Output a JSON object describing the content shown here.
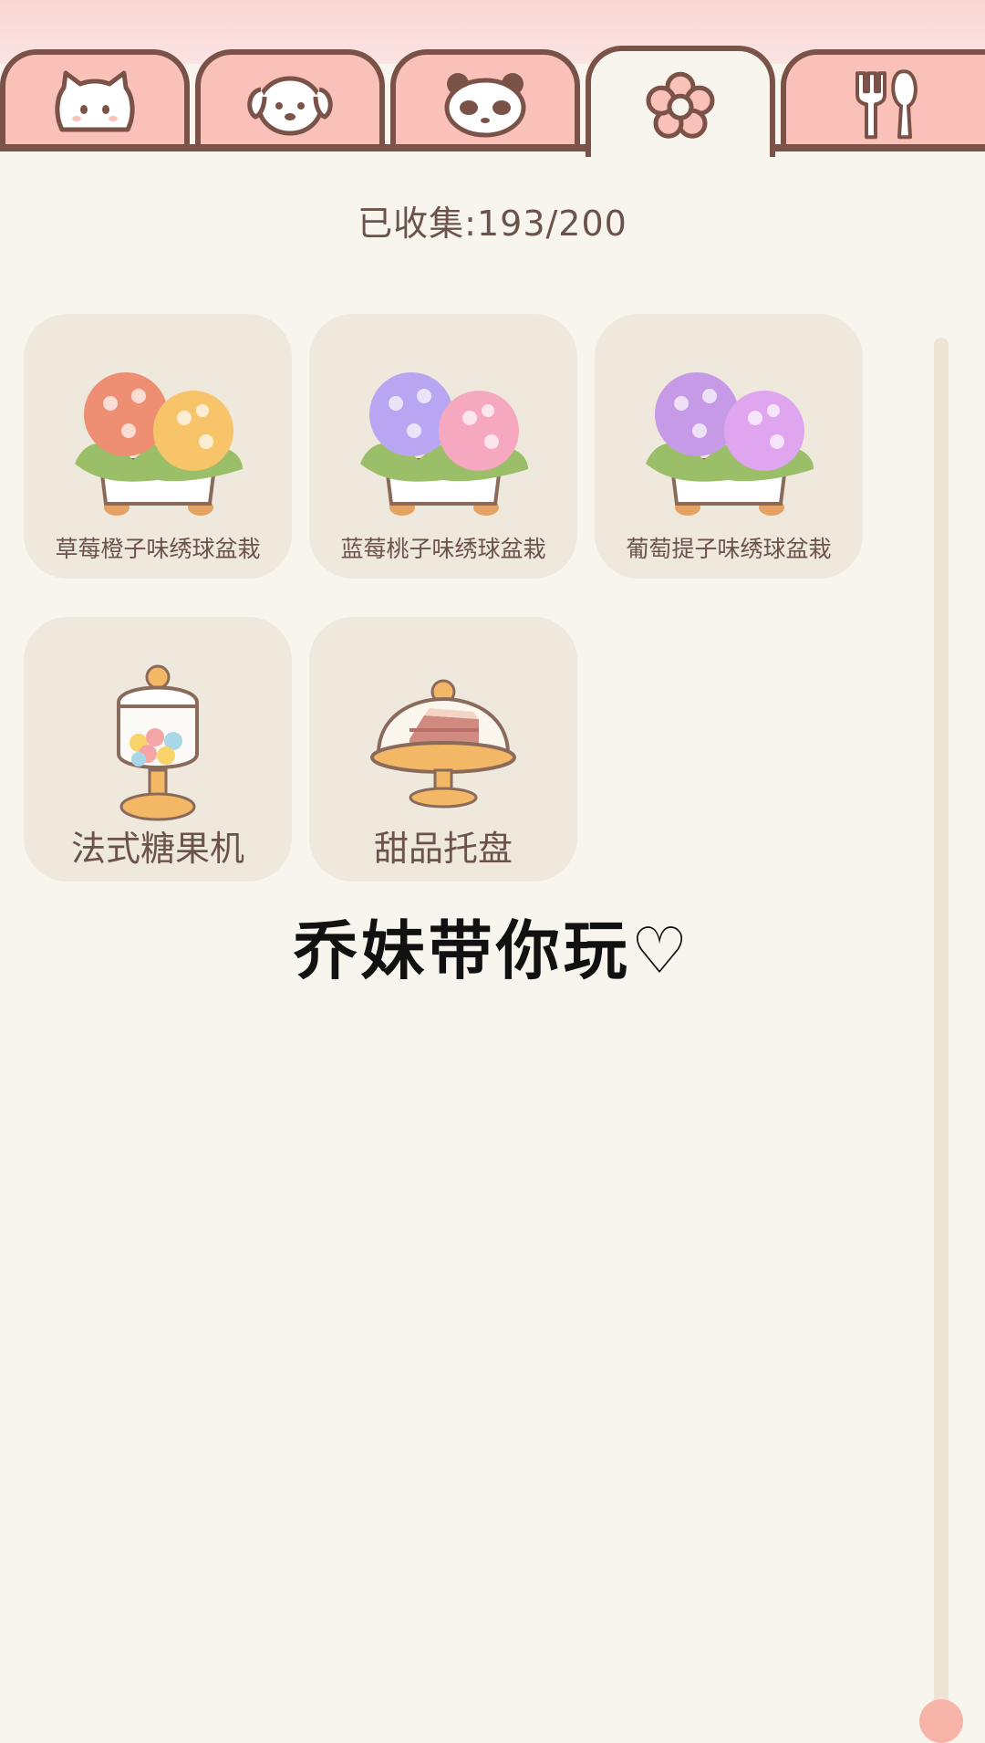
{
  "tabs": [
    {
      "icon": "cat-icon",
      "active": false
    },
    {
      "icon": "dog-icon",
      "active": false
    },
    {
      "icon": "panda-icon",
      "active": false
    },
    {
      "icon": "flower-icon",
      "active": true
    },
    {
      "icon": "fork-spoon-icon",
      "active": false
    }
  ],
  "counter": {
    "label": "已收集:",
    "value": "193/200"
  },
  "items": [
    {
      "name": "草莓橙子味绣球盆栽",
      "icon": "hydrangea-pot-icon",
      "colors": [
        "#ee8e72",
        "#f8c46a"
      ]
    },
    {
      "name": "蓝莓桃子味绣球盆栽",
      "icon": "hydrangea-pot-icon",
      "colors": [
        "#b9a6f2",
        "#f6a8c0"
      ]
    },
    {
      "name": "葡萄提子味绣球盆栽",
      "icon": "hydrangea-pot-icon",
      "colors": [
        "#c69ae6",
        "#dfa5ef"
      ]
    },
    {
      "name": "法式糖果机",
      "icon": "candy-machine-icon"
    },
    {
      "name": "甜品托盘",
      "icon": "dessert-tray-icon"
    }
  ],
  "watermark": "乔妹带你玩♡",
  "colors": {
    "accent": "#f9c1b7",
    "outline": "#7a5248",
    "card": "#efe8dd",
    "background": "#f7f5ee"
  }
}
